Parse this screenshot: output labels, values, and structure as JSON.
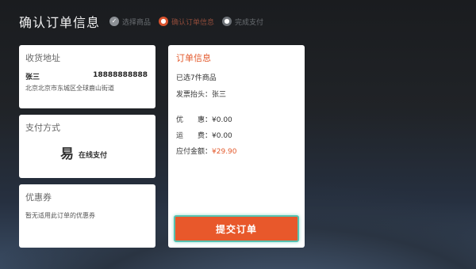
{
  "header": {
    "title": "确认订单信息",
    "steps": [
      {
        "label": "选择商品",
        "icon": "check-icon",
        "state": "done"
      },
      {
        "label": "确认订单信息",
        "icon": "step-dot-icon",
        "state": "active"
      },
      {
        "label": "完成支付",
        "icon": "step-dot-icon",
        "state": "todo"
      }
    ]
  },
  "address": {
    "title": "收货地址",
    "name": "张三",
    "phone": "18888888888",
    "detail": "北京北京市东城区全球鹿山街道"
  },
  "payment": {
    "title": "支付方式",
    "icon": "yi-payment-icon",
    "icon_glyph": "易",
    "method": "在线支付"
  },
  "coupon": {
    "title": "优惠券",
    "text": "暂无适用此订单的优惠券"
  },
  "order": {
    "title": "订单信息",
    "items_text": "已选7件商品",
    "invoice_label": "发票抬头：",
    "invoice_value": "张三",
    "discount_label": "优　　惠：",
    "discount_value": "¥0.00",
    "freight_label": "运　　费：",
    "freight_value": "¥0.00",
    "payable_label": "应付金额：",
    "payable_value": "¥29.90",
    "submit_label": "提交订单"
  },
  "colors": {
    "accent": "#e8582b",
    "focus": "#56c2b0"
  }
}
